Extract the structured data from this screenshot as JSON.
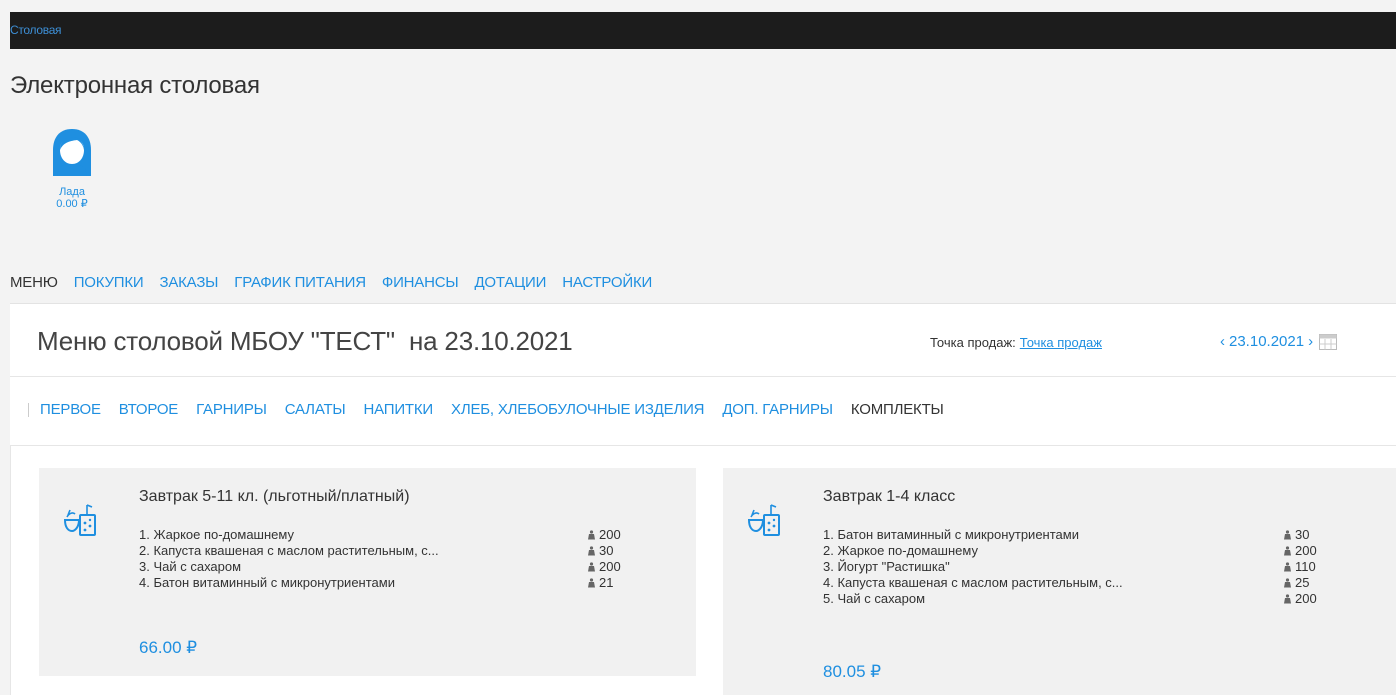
{
  "header": {
    "brand": "Столовая"
  },
  "app_title": "Электронная столовая",
  "user": {
    "name": "Лада",
    "balance": "0.00 ₽",
    "icon": "user-avatar-icon"
  },
  "nav": {
    "items": [
      {
        "label": "МЕНЮ",
        "active": true
      },
      {
        "label": "ПОКУПКИ",
        "active": false
      },
      {
        "label": "ЗАКАЗЫ",
        "active": false
      },
      {
        "label": "ГРАФИК ПИТАНИЯ",
        "active": false
      },
      {
        "label": "ФИНАНСЫ",
        "active": false
      },
      {
        "label": "ДОТАЦИИ",
        "active": false
      },
      {
        "label": "НАСТРОЙКИ",
        "active": false
      }
    ]
  },
  "menu": {
    "heading": "Меню столовой МБОУ \"ТЕСТ\"  на 23.10.2021",
    "sales_label": "Точка продаж:",
    "sales_point": "Точка продаж",
    "date": {
      "prev": "‹",
      "value": "23.10.2021",
      "next": "›",
      "icon": "calendar-icon"
    }
  },
  "categories": [
    {
      "label": "ПЕРВОЕ",
      "active": false
    },
    {
      "label": "ВТОРОЕ",
      "active": false
    },
    {
      "label": "ГАРНИРЫ",
      "active": false
    },
    {
      "label": "САЛАТЫ",
      "active": false
    },
    {
      "label": "НАПИТКИ",
      "active": false
    },
    {
      "label": "ХЛЕБ, ХЛЕБОБУЛОЧНЫЕ ИЗДЕЛИЯ",
      "active": false
    },
    {
      "label": "ДОП. ГАРНИРЫ",
      "active": false
    },
    {
      "label": "КОМПЛЕКТЫ",
      "active": true
    }
  ],
  "cards": [
    {
      "title": "Завтрак 5-11 кл. (льготный/платный)",
      "icon": "meal-bowl-drink-icon",
      "items": [
        {
          "name": "1. Жаркое по-домашнему",
          "qty": "200"
        },
        {
          "name": "2. Капуста квашеная с маслом растительным, с...",
          "qty": "30"
        },
        {
          "name": "3. Чай с сахаром",
          "qty": "200"
        },
        {
          "name": "4. Батон витаминный с микронутриентами",
          "qty": "21"
        }
      ],
      "price": "66.00 ₽"
    },
    {
      "title": "Завтрак 1-4 класс",
      "icon": "meal-bowl-drink-icon",
      "items": [
        {
          "name": "1. Батон витаминный с микронутриентами",
          "qty": "30"
        },
        {
          "name": "2. Жаркое по-домашнему",
          "qty": "200"
        },
        {
          "name": "3. Йогурт \"Растишка\"",
          "qty": "110"
        },
        {
          "name": "4. Капуста квашеная с маслом растительным, с...",
          "qty": "25"
        },
        {
          "name": "5. Чай с сахаром",
          "qty": "200"
        }
      ],
      "price": "80.05 ₽"
    }
  ],
  "colors": {
    "accent": "#1f8fe0",
    "topbar": "#1c1c1c",
    "card_bg": "#f1f1f1"
  }
}
